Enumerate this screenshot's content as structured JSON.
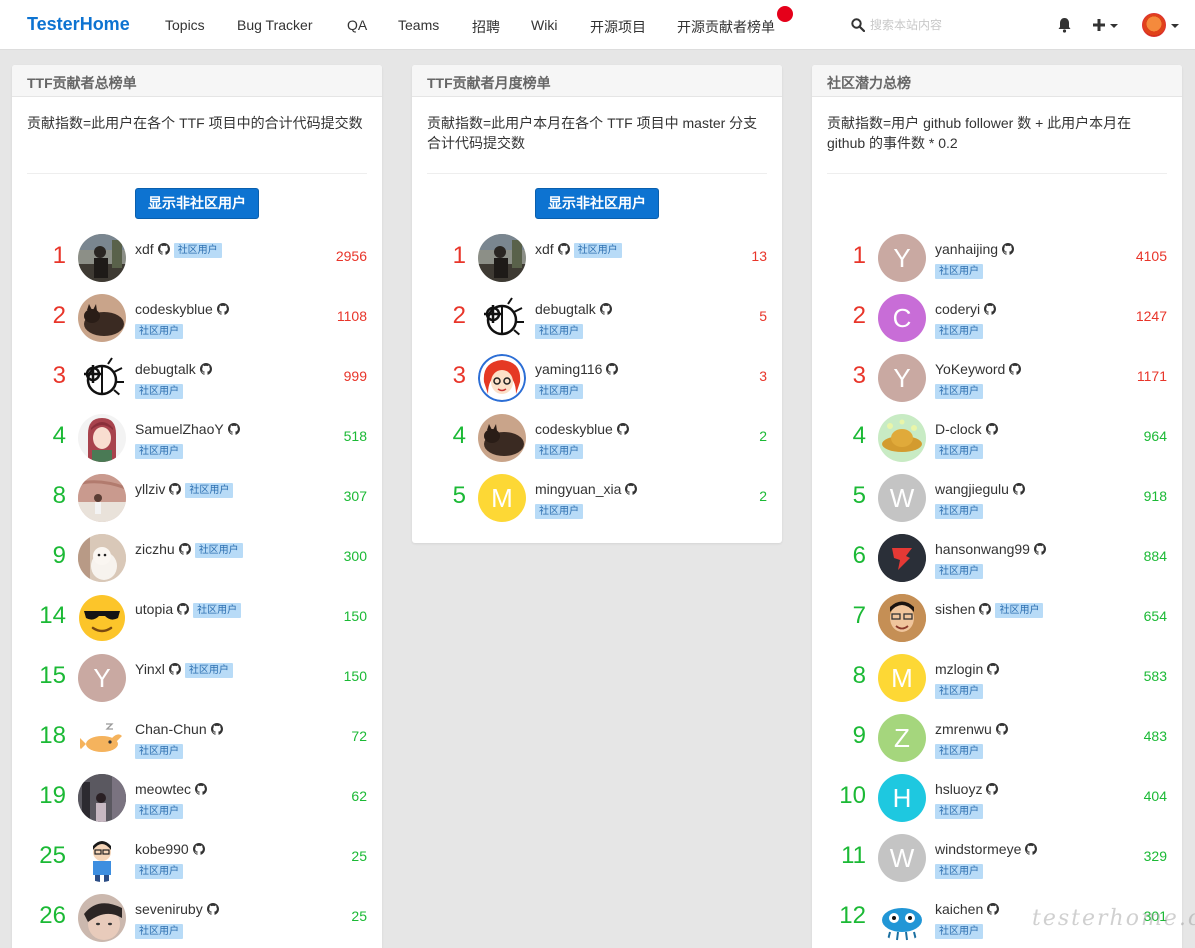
{
  "nav": {
    "brand": "TesterHome",
    "links": [
      "Topics",
      "Bug Tracker",
      "QA",
      "Teams",
      "招聘",
      "Wiki",
      "开源项目",
      "开源贡献者榜单"
    ],
    "search_placeholder": "搜索本站内容",
    "icons": {
      "search": "search-icon",
      "bell": "bell-icon",
      "plus": "plus-icon"
    }
  },
  "colors": {
    "brand": "#0d73d1",
    "rank_top": "#e8352a",
    "rank_other": "#1bb935",
    "badge_bg": "#b8dbf7"
  },
  "panels": [
    {
      "title": "TTF贡献者总榜单",
      "desc": "贡献指数=此用户在各个 TTF 项目中的合计代码提交数",
      "button": "显示非社区用户",
      "rows": [
        {
          "rank": "1",
          "name": "xdf",
          "badge": "社区用户",
          "score": "2956",
          "color": "red",
          "inline": true,
          "avatar": "photo"
        },
        {
          "rank": "2",
          "name": "codeskyblue",
          "badge": "社区用户",
          "score": "1108",
          "color": "red",
          "inline": false,
          "avatar": "cat"
        },
        {
          "rank": "3",
          "name": "debugtalk",
          "badge": "社区用户",
          "score": "999",
          "color": "red",
          "inline": false,
          "avatar": "bug"
        },
        {
          "rank": "4",
          "name": "SamuelZhaoY",
          "badge": "社区用户",
          "score": "518",
          "color": "green",
          "inline": false,
          "avatar": "anime"
        },
        {
          "rank": "8",
          "name": "yllziv",
          "badge": "社区用户",
          "score": "307",
          "color": "green",
          "inline": true,
          "avatar": "photo2"
        },
        {
          "rank": "9",
          "name": "ziczhu",
          "badge": "社区用户",
          "score": "300",
          "color": "green",
          "inline": true,
          "avatar": "dog"
        },
        {
          "rank": "14",
          "name": "utopia",
          "badge": "社区用户",
          "score": "150",
          "color": "green",
          "inline": true,
          "avatar": "emoji"
        },
        {
          "rank": "15",
          "name": "Yinxl",
          "badge": "社区用户",
          "score": "150",
          "color": "green",
          "inline": true,
          "avatar": "letter",
          "letter": "Y",
          "bg": "#c9a9a2"
        },
        {
          "rank": "18",
          "name": "Chan-Chun",
          "badge": "社区用户",
          "score": "72",
          "color": "green",
          "inline": false,
          "avatar": "fish"
        },
        {
          "rank": "19",
          "name": "meowtec",
          "badge": "社区用户",
          "score": "62",
          "color": "green",
          "inline": false,
          "avatar": "street"
        },
        {
          "rank": "25",
          "name": "kobe990",
          "badge": "社区用户",
          "score": "25",
          "color": "green",
          "inline": false,
          "avatar": "boy"
        },
        {
          "rank": "26",
          "name": "seveniruby",
          "badge": "社区用户",
          "score": "25",
          "color": "green",
          "inline": false,
          "avatar": "face"
        }
      ]
    },
    {
      "title": "TTF贡献者月度榜单",
      "desc": "贡献指数=此用户本月在各个 TTF 项目中 master 分支合计代码提交数",
      "button": "显示非社区用户",
      "rows": [
        {
          "rank": "1",
          "name": "xdf",
          "badge": "社区用户",
          "score": "13",
          "color": "red",
          "inline": true,
          "avatar": "photo"
        },
        {
          "rank": "2",
          "name": "debugtalk",
          "badge": "社区用户",
          "score": "5",
          "color": "red",
          "inline": false,
          "avatar": "bug"
        },
        {
          "rank": "3",
          "name": "yaming116",
          "badge": "社区用户",
          "score": "3",
          "color": "red",
          "inline": false,
          "avatar": "redhair"
        },
        {
          "rank": "4",
          "name": "codeskyblue",
          "badge": "社区用户",
          "score": "2",
          "color": "green",
          "inline": false,
          "avatar": "cat"
        },
        {
          "rank": "5",
          "name": "mingyuan_xia",
          "badge": "社区用户",
          "score": "2",
          "color": "green",
          "inline": false,
          "avatar": "letter",
          "letter": "M",
          "bg": "#fdd835"
        }
      ]
    },
    {
      "title": "社区潜力总榜",
      "desc": "贡献指数=用户 github follower 数 + 此用户本月在 github 的事件数 * 0.2",
      "button": "",
      "rows": [
        {
          "rank": "1",
          "name": "yanhaijing",
          "badge": "社区用户",
          "score": "4105",
          "color": "red",
          "inline": false,
          "avatar": "letter",
          "letter": "Y",
          "bg": "#c9a9a2"
        },
        {
          "rank": "2",
          "name": "coderyi",
          "badge": "社区用户",
          "score": "1247",
          "color": "red",
          "inline": false,
          "avatar": "letter",
          "letter": "C",
          "bg": "#c86dd7"
        },
        {
          "rank": "3",
          "name": "YoKeyword",
          "badge": "社区用户",
          "score": "1171",
          "color": "red",
          "inline": false,
          "avatar": "letter",
          "letter": "Y",
          "bg": "#c9a9a2"
        },
        {
          "rank": "4",
          "name": "D-clock",
          "badge": "社区用户",
          "score": "964",
          "color": "green",
          "inline": false,
          "avatar": "hat"
        },
        {
          "rank": "5",
          "name": "wangjiegulu",
          "badge": "社区用户",
          "score": "918",
          "color": "green",
          "inline": false,
          "avatar": "letter",
          "letter": "W",
          "bg": "#c4c4c4"
        },
        {
          "rank": "6",
          "name": "hansonwang99",
          "badge": "社区用户",
          "score": "884",
          "color": "green",
          "inline": false,
          "avatar": "logo"
        },
        {
          "rank": "7",
          "name": "sishen",
          "badge": "社区用户",
          "score": "654",
          "color": "green",
          "inline": true,
          "avatar": "man"
        },
        {
          "rank": "8",
          "name": "mzlogin",
          "badge": "社区用户",
          "score": "583",
          "color": "green",
          "inline": false,
          "avatar": "letter",
          "letter": "M",
          "bg": "#fdd835"
        },
        {
          "rank": "9",
          "name": "zmrenwu",
          "badge": "社区用户",
          "score": "483",
          "color": "green",
          "inline": false,
          "avatar": "letter",
          "letter": "Z",
          "bg": "#a5d67d"
        },
        {
          "rank": "10",
          "name": "hsluoyz",
          "badge": "社区用户",
          "score": "404",
          "color": "green",
          "inline": false,
          "avatar": "letter",
          "letter": "H",
          "bg": "#1ec8e0"
        },
        {
          "rank": "11",
          "name": "windstormeye",
          "badge": "社区用户",
          "score": "329",
          "color": "green",
          "inline": false,
          "avatar": "letter",
          "letter": "W",
          "bg": "#c4c4c4"
        },
        {
          "rank": "12",
          "name": "kaichen",
          "badge": "社区用户",
          "score": "301",
          "color": "green",
          "inline": false,
          "avatar": "monster"
        }
      ]
    }
  ],
  "watermark": "testerhome.com"
}
